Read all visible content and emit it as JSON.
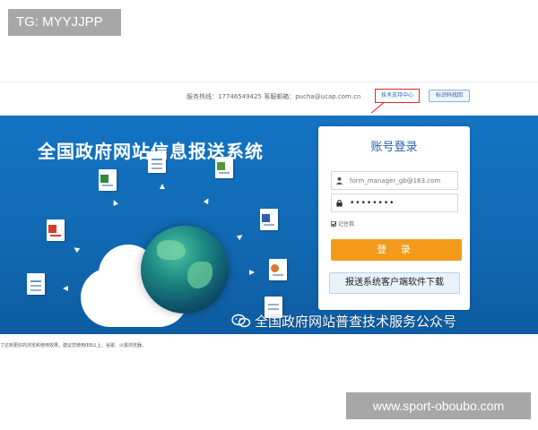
{
  "watermarks": {
    "top": "TG: MYYJJPP",
    "bottom": "www.sport-oboubo.com"
  },
  "top_bar": {
    "service": "服务热线：17746549425    客服邮箱：pucha@ucap.com.cn",
    "support_link": "技术支持中心",
    "retrieve_button": "标识码找回"
  },
  "banner": {
    "title": "全国政府网站信息报送系统"
  },
  "login": {
    "title": "账号登录",
    "username_placeholder": "form_manager_gb@163.com",
    "password_value": "••••••••",
    "remember_label": "记住我",
    "login_button": "登 录",
    "download_button": "报送系统客户端软件下载"
  },
  "footer": {
    "wechat_caption": "全国政府网站普查技术服务公众号",
    "browser_note": "了达到更好的浏览和使用效果，建议您使用IE8以上、谷歌、火狐浏览器。"
  },
  "colors": {
    "banner_blue": "#1168b1",
    "login_orange": "#f39a1b",
    "title_blue": "#2762ad",
    "highlight_red": "#e02828"
  },
  "icons": [
    "user-icon",
    "lock-icon",
    "wechat-icon",
    "globe-icon",
    "cloud-icon",
    "document-icon",
    "pdf-icon",
    "excel-icon",
    "chart-icon"
  ]
}
